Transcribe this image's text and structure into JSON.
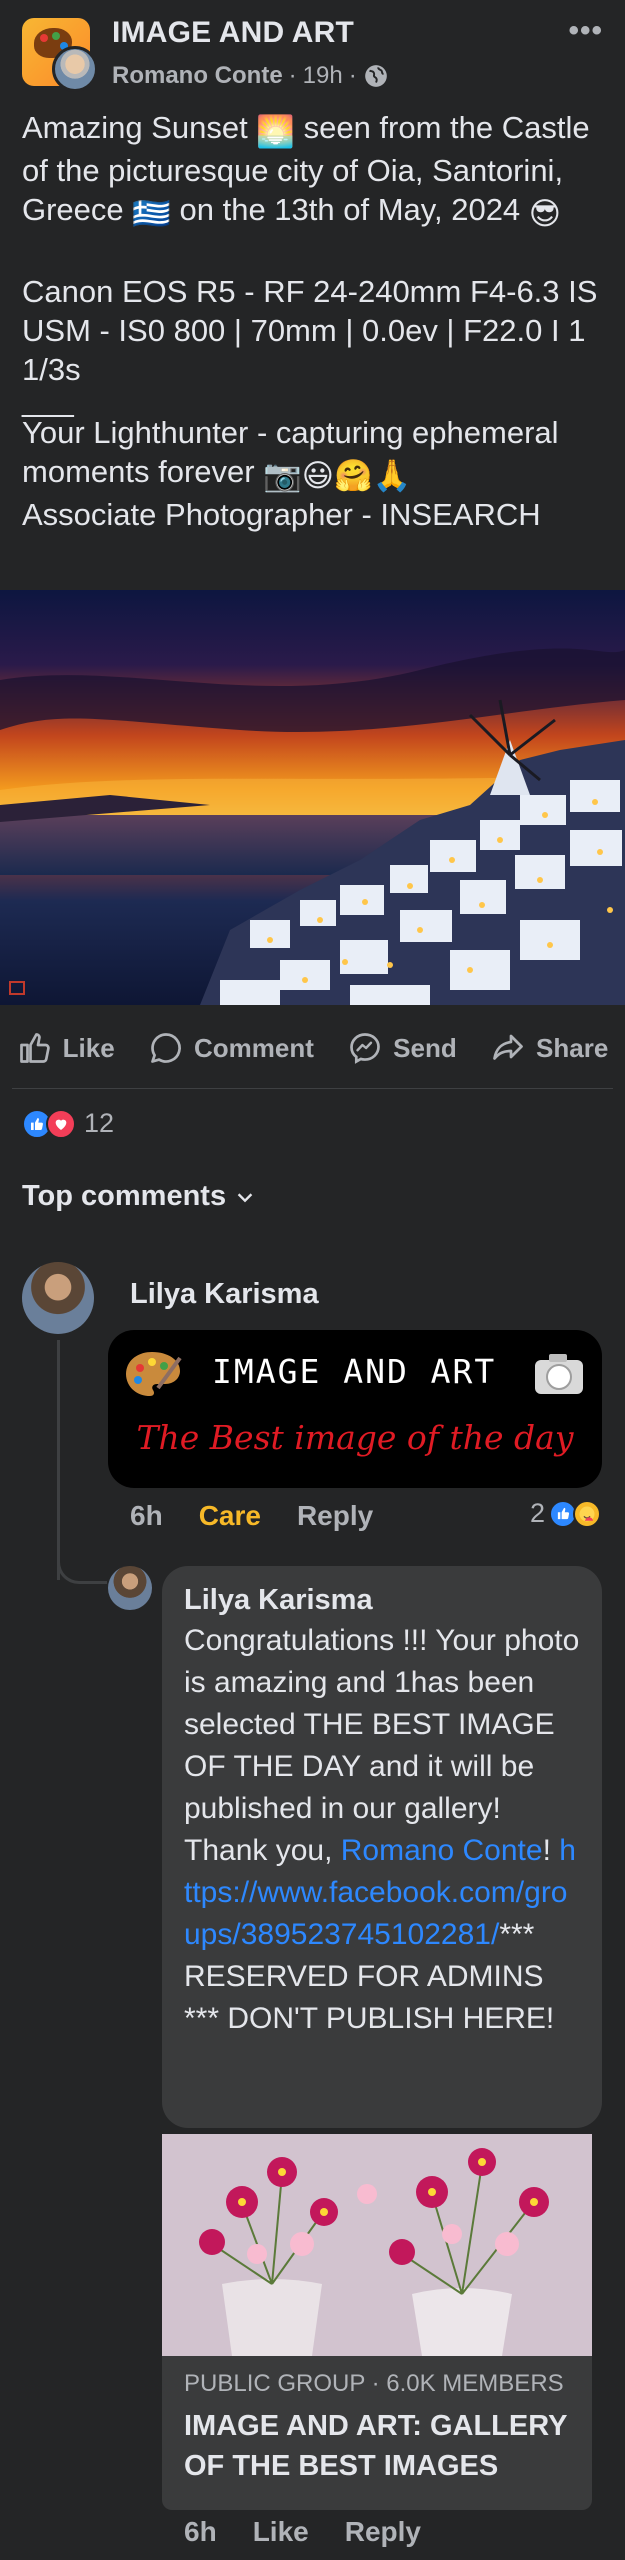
{
  "post": {
    "group_name": "IMAGE AND ART",
    "author": "Romano Conte",
    "time": "19h",
    "separator": "·",
    "text_line1a": "Amazing Sunset ",
    "text_line1b": " seen from the Castle of the picturesque city of Oia, Santorini, Greece ",
    "text_line1c": " on the 13th of May, 2024 ",
    "text_line2": "Canon EOS R5 - RF 24-240mm F4-6.3 IS USM - IS0 800 | 70mm | 0.0ev | F22.0 I 1 1/3s",
    "text_line3": "___",
    "text_line4": "Your Lighthunter - capturing ephemeral moments forever ",
    "text_line5": "Associate Photographer - INSEARCH",
    "emoji_sunset": "🌅",
    "emoji_flag": "🇬🇷",
    "emoji_sunglasses": "😎",
    "emoji_tail": "📷😃🤗🙏"
  },
  "actions": {
    "like": "Like",
    "comment": "Comment",
    "send": "Send",
    "share": "Share"
  },
  "reactions": {
    "count": "12"
  },
  "comments_header": "Top comments",
  "comment1": {
    "name": "Lilya Karisma",
    "banner_title": "IMAGE AND ART",
    "banner_subtitle": "The Best image of the day",
    "time": "6h",
    "care": "Care",
    "reply": "Reply",
    "reaction_count": "2"
  },
  "comment2": {
    "name": "Lilya Karisma",
    "text_a": "Congratulations !!! Your photo is amazing and 1has been selected THE BEST IMAGE OF THE DAY and it will be published in our gallery! Thank you, ",
    "mention": "Romano Conte",
    "text_b": "! ",
    "link": "https://www.facebook.com/groups/389523745102281/",
    "text_c": "*** RESERVED FOR ADMINS *** DON'T PUBLISH HERE!",
    "preview_meta": "PUBLIC GROUP · 6.0K MEMBERS",
    "preview_title": "IMAGE AND ART: GALLERY OF THE BEST IMAGES",
    "time": "6h",
    "like": "Like",
    "reply": "Reply"
  },
  "colors": {
    "background": "#242526",
    "bubble": "#3a3b3c",
    "link": "#2d88ff",
    "care": "#f7b928",
    "banner_subtitle": "#e01b24"
  }
}
